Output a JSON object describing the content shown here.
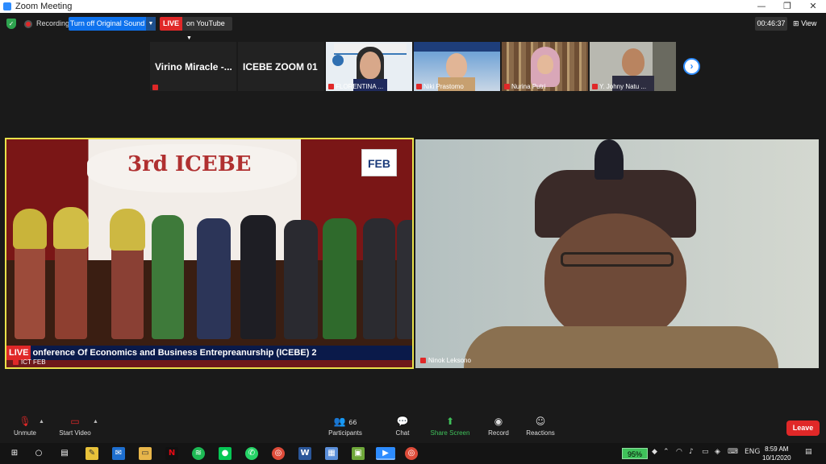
{
  "window": {
    "title": "Zoom Meeting",
    "minimize": "—",
    "maximize": "❐",
    "close": "✕"
  },
  "topbar": {
    "recording_label": "Recording",
    "sound_button": "Turn off Original Sound",
    "live_badge": "LIVE",
    "live_destination": "on YouTube",
    "timer": "00:46:37",
    "view_label": "View"
  },
  "strip": {
    "name_tiles": [
      "Virino Miracle -...",
      "ICEBE ZOOM 01"
    ],
    "video_tiles": [
      "FLORENTINA ...",
      "Niki Prastomo",
      "Nurina Putri",
      "Y. Johny Natu ..."
    ],
    "next_arrow": "›"
  },
  "main": {
    "left": {
      "event_logo_text": "3rd ICEBE",
      "feb_logo_text": "FEB",
      "ticker_live": "LIVE",
      "ticker_text": "onference Of Economics and Business Entrepreanurship (ICEBE) 2",
      "participant_name": "ICT FEB"
    },
    "right": {
      "participant_name": "Ninok Leksono"
    }
  },
  "toolbar": {
    "unmute": "Unmute",
    "start_video": "Start Video",
    "participants": "Participants",
    "participants_count": "66",
    "chat": "Chat",
    "share_screen": "Share Screen",
    "record": "Record",
    "reactions": "Reactions",
    "leave": "Leave"
  },
  "taskbar": {
    "battery": "95%",
    "language": "ENG",
    "time": "8:59 AM",
    "date": "10/1/2020"
  },
  "colors": {
    "accent": "#0e72ed",
    "live": "#e02828",
    "active_speaker": "#e9e24a",
    "share_green": "#3fc15a"
  }
}
